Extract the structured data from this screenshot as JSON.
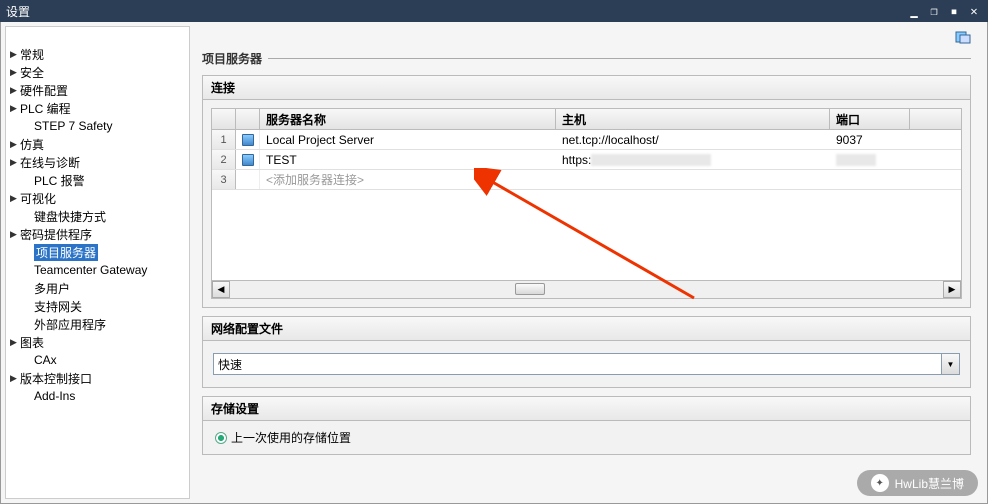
{
  "window": {
    "title": "设置",
    "controls": {
      "minimize": "▁",
      "restore": "❐",
      "smallx": "▪",
      "close": "✕"
    }
  },
  "sidebar": {
    "items": [
      {
        "label": "常规",
        "expandable": true
      },
      {
        "label": "安全",
        "expandable": true
      },
      {
        "label": "硬件配置",
        "expandable": true
      },
      {
        "label": "PLC 编程",
        "expandable": true
      },
      {
        "label": "STEP 7 Safety",
        "expandable": false,
        "child": true
      },
      {
        "label": "仿真",
        "expandable": true
      },
      {
        "label": "在线与诊断",
        "expandable": true
      },
      {
        "label": "PLC 报警",
        "expandable": false,
        "child": true
      },
      {
        "label": "可视化",
        "expandable": true
      },
      {
        "label": "键盘快捷方式",
        "expandable": false,
        "child": true
      },
      {
        "label": "密码提供程序",
        "expandable": true
      },
      {
        "label": "项目服务器",
        "expandable": false,
        "child": true,
        "selected": true
      },
      {
        "label": "Teamcenter Gateway",
        "expandable": false,
        "child": true
      },
      {
        "label": "多用户",
        "expandable": false,
        "child": true
      },
      {
        "label": "支持网关",
        "expandable": false,
        "child": true
      },
      {
        "label": "外部应用程序",
        "expandable": false,
        "child": true
      },
      {
        "label": "图表",
        "expandable": true
      },
      {
        "label": "CAx",
        "expandable": false,
        "child": true
      },
      {
        "label": "版本控制接口",
        "expandable": true
      },
      {
        "label": "Add-Ins",
        "expandable": false,
        "child": true
      }
    ]
  },
  "contentTitle": "项目服务器",
  "connectionPanel": {
    "title": "连接",
    "columns": {
      "name": "服务器名称",
      "host": "主机",
      "port": "端口"
    },
    "rows": [
      {
        "num": "1",
        "name": "Local Project Server",
        "host": "net.tcp://localhost/",
        "port": "9037"
      },
      {
        "num": "2",
        "name": "TEST",
        "host": "https:",
        "port": ""
      },
      {
        "num": "3",
        "name": "<添加服务器连接>",
        "host": "",
        "port": "",
        "placeholder": true
      }
    ]
  },
  "networkPanel": {
    "title": "网络配置文件",
    "value": "快速"
  },
  "storagePanel": {
    "title": "存储设置",
    "radioLabel": "上一次使用的存储位置"
  },
  "watermark": "HwLib慧兰博"
}
